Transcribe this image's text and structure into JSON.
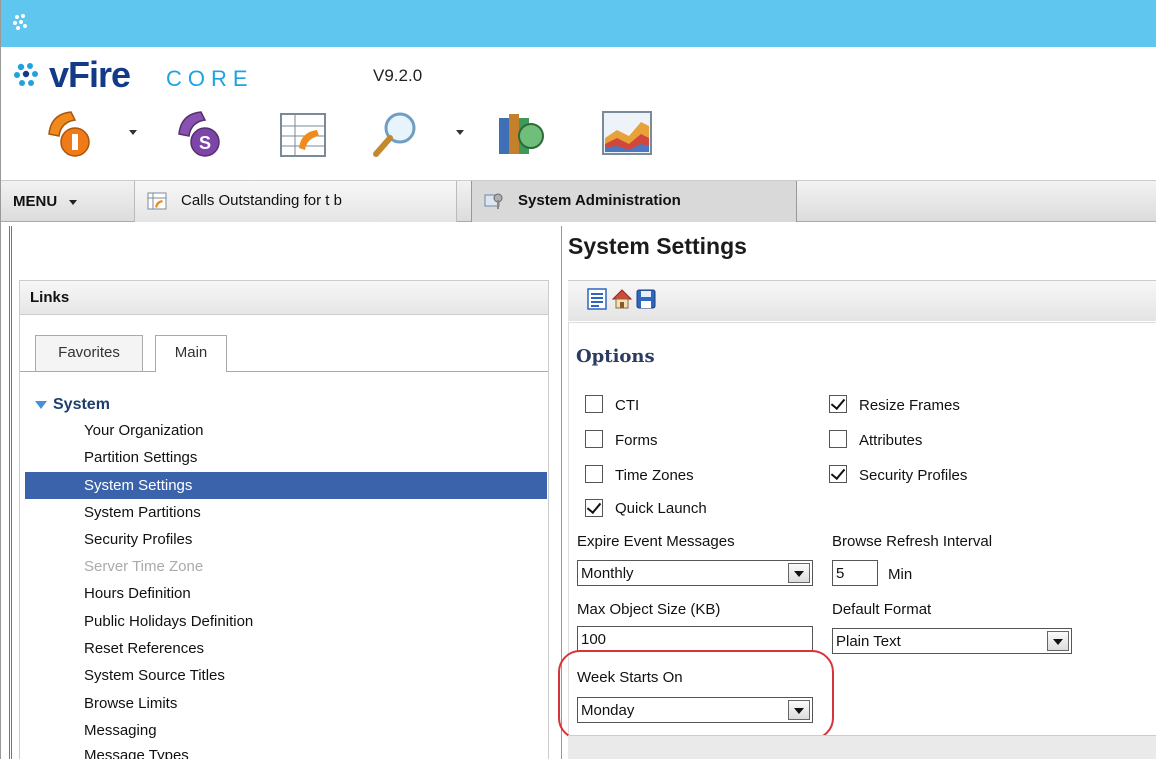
{
  "app": {
    "logo_text": "vFire",
    "logo_subtext": "CORE",
    "version": "V9.2.0"
  },
  "toolbar": {
    "icons": [
      "incident-call-icon",
      "service-request-call-icon",
      "calls-outstanding-icon",
      "search-icon",
      "knowledge-books-icon",
      "reports-chart-icon"
    ]
  },
  "tabs": {
    "menu_label": "MENU",
    "items": [
      {
        "label": "Calls Outstanding for t b",
        "icon": "calls-outstanding-icon"
      },
      {
        "label": "System Administration",
        "icon": "system-admin-icon"
      }
    ]
  },
  "links": {
    "title": "Links",
    "tabs": [
      "Favorites",
      "Main"
    ],
    "root": "System",
    "items": [
      {
        "label": "Your Organization"
      },
      {
        "label": "Partition Settings"
      },
      {
        "label": "System Settings"
      },
      {
        "label": "System Partitions"
      },
      {
        "label": "Security Profiles"
      },
      {
        "label": "Server Time Zone"
      },
      {
        "label": "Hours Definition"
      },
      {
        "label": "Public Holidays Definition"
      },
      {
        "label": "Reset References"
      },
      {
        "label": "System Source Titles"
      },
      {
        "label": "Browse Limits"
      },
      {
        "label": "Messaging"
      },
      {
        "label": "Message Types"
      }
    ],
    "selected_item": "System Settings",
    "disabled_item": "Server Time Zone"
  },
  "settings": {
    "title": "System Settings",
    "toolbar_icons": [
      "details-icon",
      "home-icon",
      "save-icon"
    ],
    "options_title": "Options",
    "checkboxes": [
      {
        "label": "CTI",
        "checked": false
      },
      {
        "label": "Forms",
        "checked": false
      },
      {
        "label": "Time Zones",
        "checked": false
      },
      {
        "label": "Quick Launch",
        "checked": true
      },
      {
        "label": "Resize Frames",
        "checked": true
      },
      {
        "label": "Attributes",
        "checked": false
      },
      {
        "label": "Security Profiles",
        "checked": true
      }
    ],
    "expire_label": "Expire Event Messages",
    "expire_value": "Monthly",
    "refresh_label": "Browse Refresh Interval",
    "refresh_value": "5",
    "refresh_unit": "Min",
    "maxsize_label": "Max Object Size (KB)",
    "maxsize_value": "100",
    "format_label": "Default Format",
    "format_value": "Plain Text",
    "week_label": "Week Starts On",
    "week_value": "Monday"
  },
  "colors": {
    "titlebar": "#5ec6ef",
    "selection": "#3a63ac",
    "highlight_ring": "#d9333a",
    "brand_blue": "#123a88"
  }
}
